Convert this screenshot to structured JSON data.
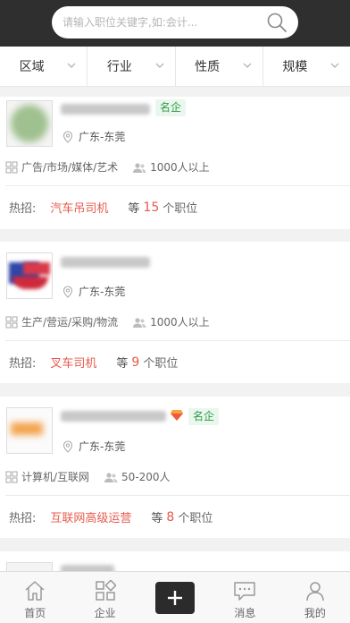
{
  "search": {
    "placeholder": "请输入职位关键字,如:会计..."
  },
  "filters": [
    "区域",
    "行业",
    "性质",
    "规模"
  ],
  "companies": [
    {
      "badge": "名企",
      "location": "广东-东莞",
      "industry": "广告/市场/媒体/艺术",
      "size": "1000人以上",
      "hot_label": "热招:",
      "hot_job": "汽车吊司机",
      "more_prefix": "等",
      "count": "15",
      "more_suffix": "个职位"
    },
    {
      "badge": "",
      "location": "广东-东莞",
      "industry": "生产/营运/采购/物流",
      "size": "1000人以上",
      "hot_label": "热招:",
      "hot_job": "叉车司机",
      "more_prefix": "等",
      "count": "9",
      "more_suffix": "个职位"
    },
    {
      "badge": "名企",
      "location": "广东-东莞",
      "industry": "计算机/互联网",
      "size": "50-200人",
      "hot_label": "热招:",
      "hot_job": "互联网高级运营",
      "more_prefix": "等",
      "count": "8",
      "more_suffix": "个职位"
    }
  ],
  "tabs": [
    "首页",
    "企业",
    "",
    "消息",
    "我的"
  ],
  "colors": {
    "accent_red": "#e75a4d",
    "badge_green": "#2f9a45",
    "topbar": "#2f2f2f"
  }
}
